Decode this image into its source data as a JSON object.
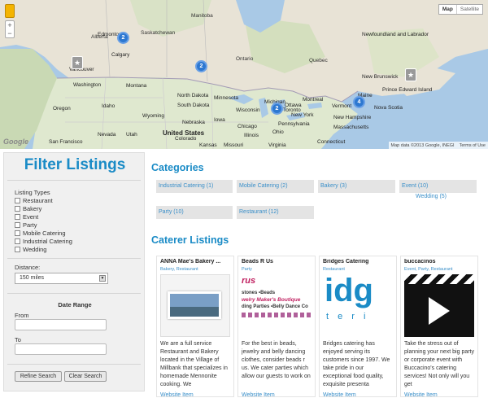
{
  "map": {
    "type_buttons": [
      "Map",
      "Satellite"
    ],
    "zoom_in": "+",
    "zoom_out": "−",
    "logo": "Google",
    "attribution": "Map data ©2013 Google, INEGI",
    "terms": "Terms of Use",
    "labels": {
      "alberta": "Alberta",
      "manitoba": "Manitoba",
      "saskatchewan": "Saskatchewan",
      "ontario": "Ontario",
      "quebec": "Quebec",
      "edmonton": "Edmonton",
      "calgary": "Calgary",
      "vancouver": "Vancouver",
      "washington": "Washington",
      "oregon": "Oregon",
      "idaho": "Idaho",
      "montana": "Montana",
      "wyoming": "Wyoming",
      "nevada": "Nevada",
      "utah": "Utah",
      "colorado": "Colorado",
      "north_dakota": "North Dakota",
      "south_dakota": "South Dakota",
      "nebraska": "Nebraska",
      "minnesota": "Minnesota",
      "iowa": "Iowa",
      "wisconsin": "Wisconsin",
      "michigan": "Michigan",
      "illinois": "Illinois",
      "chicago": "Chicago",
      "ohio": "Ohio",
      "pennsylvania": "Pennsylvania",
      "united_states": "United States",
      "kansas": "Kansas",
      "missouri": "Missouri",
      "montreal": "Montreal",
      "ottawa": "Ottawa",
      "toronto": "Toronto",
      "new_york": "New York",
      "vermont": "Vermont",
      "new_hampshire": "New Hampshire",
      "maine": "Maine",
      "massachusetts": "Massachusetts",
      "connecticut": "Connecticut",
      "virginia": "Virginia",
      "newfoundland": "Newfoundland and Labrador",
      "new_brunswick": "New Brunswick",
      "pei": "Prince Edward Island",
      "nova_scotia": "Nova Scotia",
      "san_francisco": "San Francisco"
    },
    "clusters": [
      "2",
      "2",
      "2",
      "4"
    ],
    "pins": [
      "★",
      "★"
    ]
  },
  "sidebar": {
    "title": "Filter Listings",
    "listing_types_label": "Listing Types",
    "listing_types": [
      "Restaurant",
      "Bakery",
      "Event",
      "Party",
      "Mobile Catering",
      "Industrial Catering",
      "Wedding"
    ],
    "distance_label": "Distance:",
    "distance_value": "150 miles",
    "date_range_title": "Date Range",
    "from_label": "From",
    "to_label": "To",
    "refine_button": "Refine Search",
    "clear_button": "Clear Search"
  },
  "categories": {
    "title": "Categories",
    "items": [
      "Industrial Catering (1)",
      "Mobile Catering (2)",
      "Bakery (3)",
      "Event (10)",
      "Party (10)",
      "Restaurant (12)"
    ],
    "sub_item": "Wedding (5)"
  },
  "listings": {
    "title": "Caterer Listings",
    "cards": [
      {
        "name": "ANNA Mae's Bakery ...",
        "tags": "Bakery, Restaurant",
        "desc": "We are a full service Restaurant and Bakery located in the Village of Millbank that specializes in homemade Mennonite cooking. We",
        "link": "Website Item"
      },
      {
        "name": "Beads R Us",
        "tags": "Party",
        "desc": "For the best in beads, jewelry and belly dancing clothes, consider beads r us. We cater parties which allow our guests to work on",
        "link": "Website Item",
        "img_text": [
          "rus",
          "stones •Beads",
          "welry Maker's Boutique",
          "ding Parties •Belly Dance Co"
        ]
      },
      {
        "name": "Bridges Catering",
        "tags": "Restaurant",
        "desc": "Bridges catering has enjoyed serving its customers since 1997. We take pride in our exceptional food quality, exquisite presenta",
        "link": "Website Item",
        "img_text": [
          "idg",
          "t e r i"
        ]
      },
      {
        "name": "buccacinos",
        "tags": "Event, Party, Restaurant",
        "desc": "Take the stress out of planning your next big party or corporate event with Buccacino's catering services! Not only will you get",
        "link": "Website Item"
      }
    ]
  }
}
